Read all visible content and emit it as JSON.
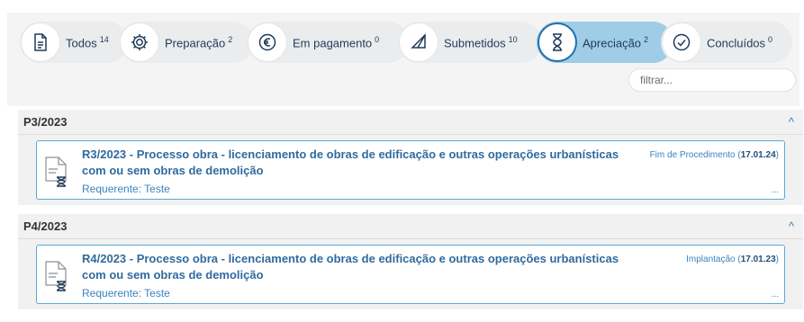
{
  "tabs": [
    {
      "label": "Todos",
      "count": "14",
      "icon": "document-icon"
    },
    {
      "label": "Preparação",
      "count": "2",
      "icon": "gear-icon"
    },
    {
      "label": "Em pagamento",
      "count": "0",
      "icon": "euro-icon"
    },
    {
      "label": "Submetidos",
      "count": "10",
      "icon": "paper-plane-icon"
    },
    {
      "label": "Apreciação",
      "count": "2",
      "icon": "hourglass-icon",
      "active": true
    },
    {
      "label": "Concluídos",
      "count": "0",
      "icon": "check-circle-icon"
    }
  ],
  "filter": {
    "placeholder": "filtrar..."
  },
  "groups": [
    {
      "code": "P3/2023",
      "process": {
        "title": "R3/2023 - Processo obra - licenciamento de obras de edificação e outras operações urbanísticas com ou sem obras de demolição",
        "requester": "Requerente: Teste",
        "status": "Fim de Procedimento",
        "date": "17.01.24",
        "more": "..."
      }
    },
    {
      "code": "P4/2023",
      "process": {
        "title": "R4/2023 - Processo obra - licenciamento de obras de edificação e outras operações urbanísticas com ou sem obras de demolição",
        "requester": "Requerente: Teste",
        "status": "Implantação",
        "date": "17.01.23",
        "more": "..."
      }
    }
  ],
  "colors": {
    "accent": "#2f6b9e",
    "active_tab": "#9fcde8",
    "border": "#5aa8d6"
  }
}
